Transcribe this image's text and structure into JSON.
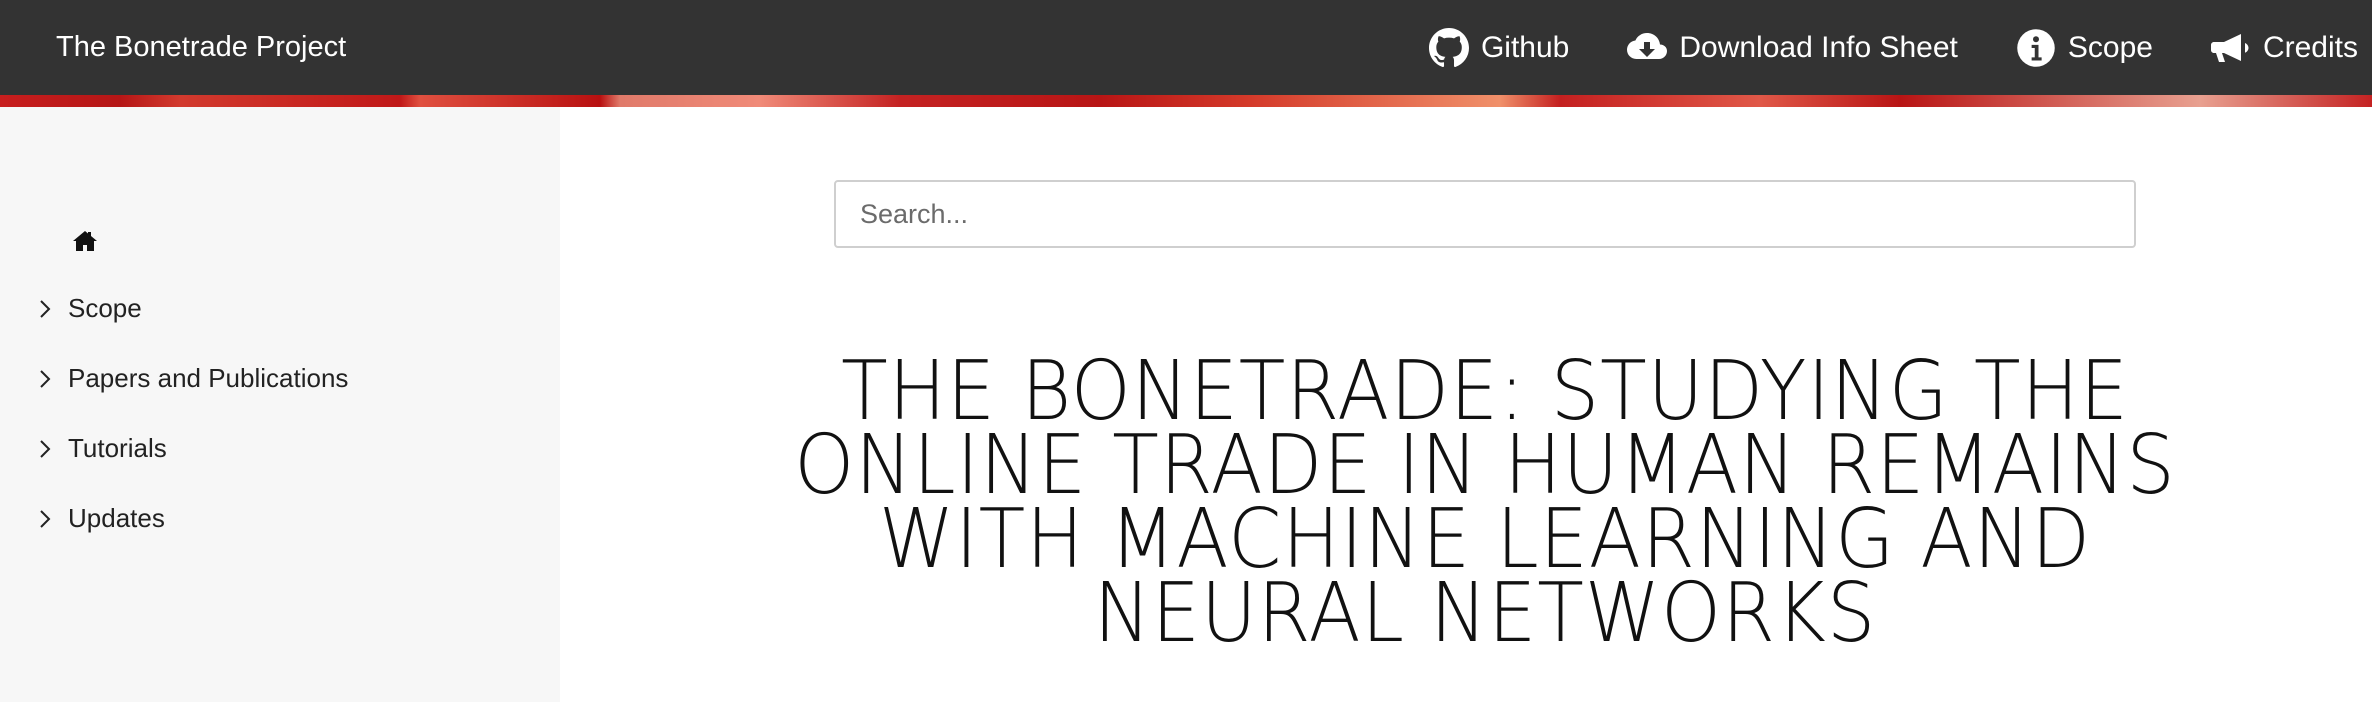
{
  "navbar": {
    "brand": "The Bonetrade Project",
    "links": [
      {
        "label": "Github",
        "icon": "github-icon"
      },
      {
        "label": "Download Info Sheet",
        "icon": "cloud-download-icon"
      },
      {
        "label": "Scope",
        "icon": "info-circle-icon"
      },
      {
        "label": "Credits",
        "icon": "megaphone-icon"
      }
    ]
  },
  "sidebar": {
    "home_icon": "home-icon",
    "items": [
      {
        "label": "Scope"
      },
      {
        "label": "Papers and Publications"
      },
      {
        "label": "Tutorials"
      },
      {
        "label": "Updates"
      }
    ]
  },
  "search": {
    "placeholder": "Search...",
    "value": ""
  },
  "main": {
    "title": "THE BONETRADE: STUDYING THE ONLINE TRADE IN HUMAN REMAINS WITH MACHINE LEARNING AND NEURAL NETWORKS"
  },
  "colors": {
    "navbar_bg": "#333333",
    "banner_accent": "#c81e1e",
    "sidebar_bg": "#f7f7f7"
  }
}
